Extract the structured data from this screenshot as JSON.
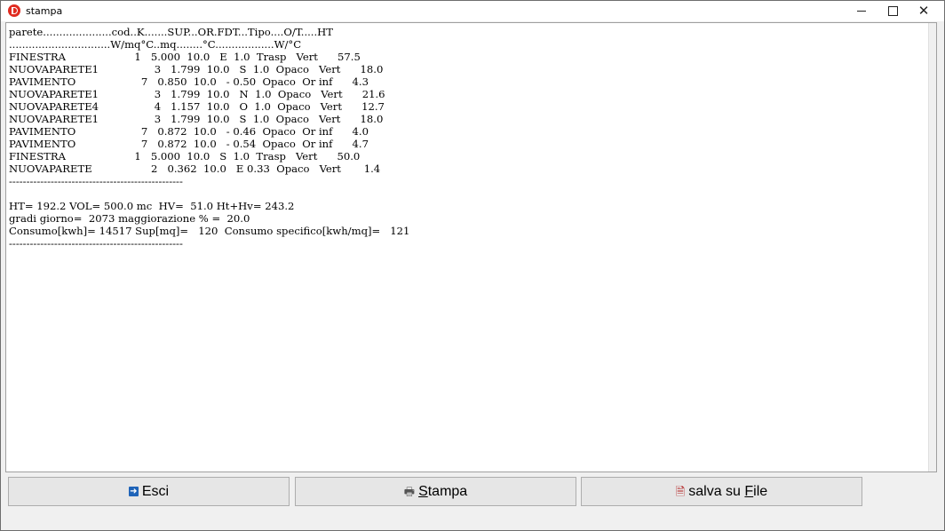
{
  "window": {
    "title": "stampa",
    "minimize_icon": "minimize-icon",
    "maximize_icon": "maximize-icon",
    "close_icon": "close-icon"
  },
  "report": {
    "lines": [
      "parete.....................cod..K.......SUP...OR.FDT...Tipo....O/T.....HT",
      "...............................W/mq°C..mq........°C..................W/°C",
      "FINESTRA                     1   5.000  10.0   E  1.0  Trasp   Vert      57.5",
      "NUOVAPARETE1                 3   1.799  10.0   S  1.0  Opaco   Vert      18.0",
      "PAVIMENTO                    7   0.850  10.0   - 0.50  Opaco  Or inf      4.3",
      "NUOVAPARETE1                 3   1.799  10.0   N  1.0  Opaco   Vert      21.6",
      "NUOVAPARETE4                 4   1.157  10.0   O  1.0  Opaco   Vert      12.7",
      "NUOVAPARETE1                 3   1.799  10.0   S  1.0  Opaco   Vert      18.0",
      "PAVIMENTO                    7   0.872  10.0   - 0.46  Opaco  Or inf      4.0",
      "PAVIMENTO                    7   0.872  10.0   - 0.54  Opaco  Or inf      4.7",
      "FINESTRA                     1   5.000  10.0   S  1.0  Trasp   Vert      50.0",
      "NUOVAPARETE                  2   0.362  10.0   E 0.33  Opaco   Vert       1.4",
      "--------------------------------------------------",
      "",
      "HT= 192.2 VOL= 500.0 mc  HV=  51.0 Ht+Hv= 243.2",
      "gradi giorno=  2073 maggiorazione % =  20.0",
      "Consumo[kwh]= 14517 Sup[mq]=   120  Consumo specifico[kwh/mq]=   121",
      "--------------------------------------------------"
    ]
  },
  "buttons": {
    "esci": {
      "label": "Esci",
      "icon": "exit-icon"
    },
    "stampa": {
      "label_underlined": "S",
      "label_rest": "tampa",
      "icon": "printer-icon"
    },
    "salva": {
      "label_prefix": "salva su ",
      "label_underlined": "F",
      "label_rest": "ile",
      "icon": "save-file-icon"
    }
  },
  "colors": {
    "app_icon": "#e02b20",
    "button_face": "#e6e6e6",
    "report_background": "#ffffff"
  }
}
